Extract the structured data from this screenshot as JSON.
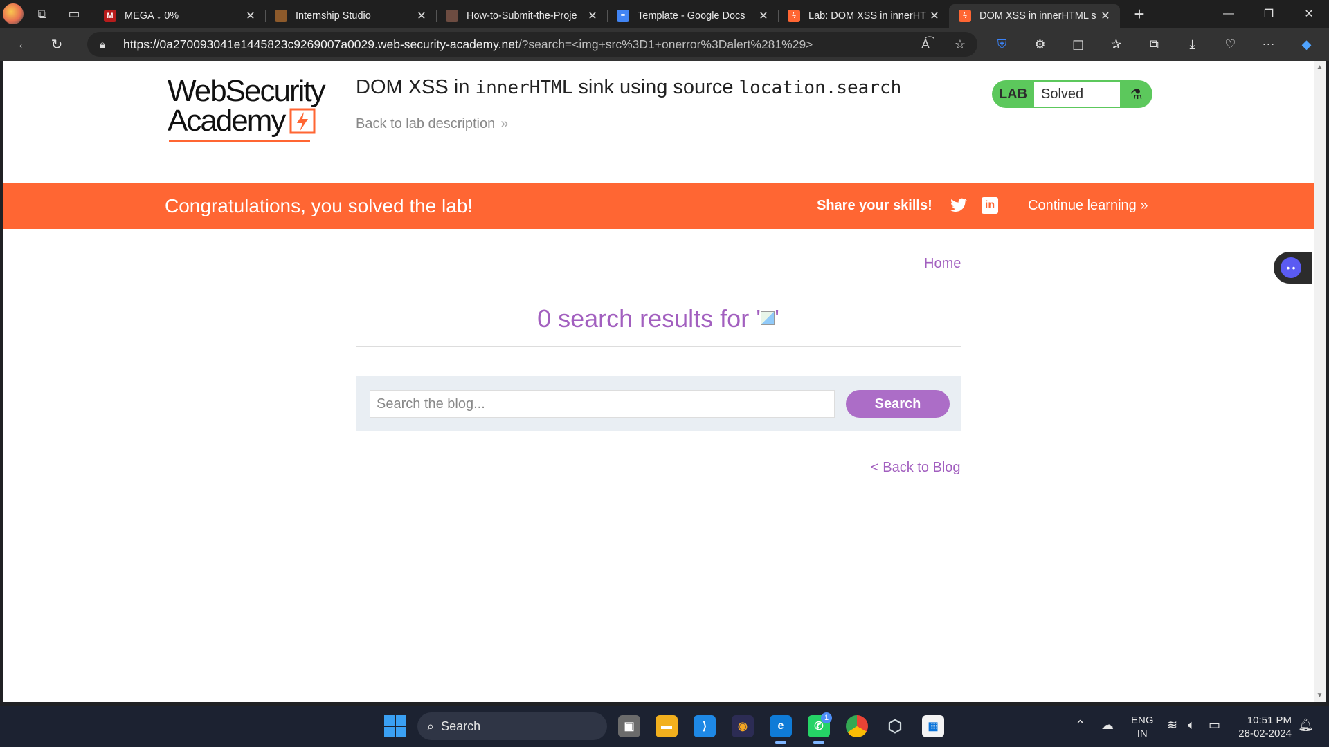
{
  "browser": {
    "tabs": [
      {
        "title": "MEGA ↓ 0%",
        "fav_color": "#b71c1c",
        "fav_text": "M"
      },
      {
        "title": "Internship Studio",
        "fav_color": "#8d5a2b",
        "fav_text": ""
      },
      {
        "title": "How-to-Submit-the-Proje",
        "fav_color": "#6d4c41",
        "fav_text": ""
      },
      {
        "title": "Template - Google Docs",
        "fav_color": "#4285f4",
        "fav_text": "≡"
      },
      {
        "title": "Lab: DOM XSS in innerHT",
        "fav_color": "#ff6633",
        "fav_text": "ϟ"
      },
      {
        "title": "DOM XSS in innerHTML s",
        "fav_color": "#ff6633",
        "fav_text": "ϟ",
        "active": true
      }
    ],
    "url_host": "https://0a270093041e1445823c9269007a0029.web-security-academy.net",
    "url_rest": "/?search=<img+src%3D1+onerror%3Dalert%281%29>"
  },
  "page": {
    "logo_line1": "WebSecurity",
    "logo_line2": "Academy",
    "lab_title_pre": "DOM XSS in ",
    "lab_title_code1": "innerHTML",
    "lab_title_mid": " sink using source ",
    "lab_title_code2": "location.search",
    "back_to_lab": "Back to lab description",
    "lab_tag": "LAB",
    "lab_status": "Solved",
    "banner_message": "Congratulations, you solved the lab!",
    "share_label": "Share your skills!",
    "continue_learning": "Continue learning",
    "home_link": "Home",
    "results_text": "0 search results for '",
    "results_close": "'",
    "search_placeholder": "Search the blog...",
    "search_button": "Search",
    "back_to_blog": "< Back to Blog"
  },
  "taskbar": {
    "search_label": "Search",
    "whatsapp_badge": "1",
    "lang_line1": "ENG",
    "lang_line2": "IN",
    "time": "10:51 PM",
    "date": "28-02-2024"
  },
  "colors": {
    "accent_orange": "#ff6633",
    "link_purple": "#a25fbf",
    "lab_green": "#5cc85c"
  }
}
